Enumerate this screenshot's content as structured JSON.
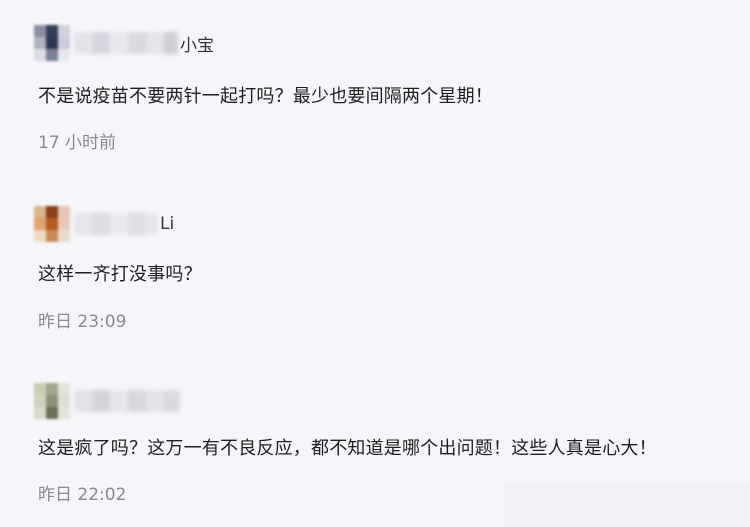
{
  "comments": [
    {
      "username_visible": "小宝",
      "text": "不是说疫苗不要两针一起打吗？最少也要间隔两个星期！",
      "time": "17 小时前",
      "avatar_colors": [
        "#8a8fa3",
        "#343e57",
        "#cfd1dc",
        "#aeb2c2",
        "#2f3752",
        "#c9ccd8",
        "#dcdde6",
        "#7a8098",
        "#e6e6ee"
      ]
    },
    {
      "username_visible": "Li",
      "text": "这样一齐打没事吗？",
      "time": "昨日 23:09",
      "avatar_colors": [
        "#d9b48b",
        "#8a3e1a",
        "#e6c7b7",
        "#e3a46a",
        "#b45a1f",
        "#e8c9b9",
        "#efd8c4",
        "#c98a54",
        "#ead9cf"
      ]
    },
    {
      "username_visible": "",
      "text": "这是疯了吗？这万一有不良反应，都不知道是哪个出问题！这些人真是心大！",
      "time": "昨日 22:02",
      "avatar_colors": [
        "#c9cdb2",
        "#a3a78a",
        "#e3e3d9",
        "#cfd2bd",
        "#8e9475",
        "#dedfd3",
        "#d9dbc9",
        "#6b7258",
        "#e4e4dc"
      ]
    }
  ],
  "watermark_text": ""
}
